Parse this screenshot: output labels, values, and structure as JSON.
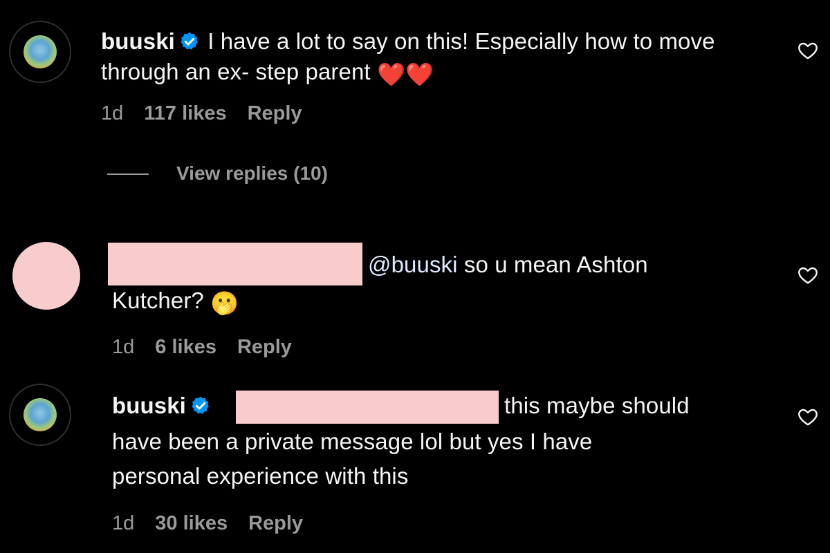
{
  "comments": [
    {
      "username": "buuski",
      "verified": true,
      "text_line1": "I have a lot to say on this! Especially how to move",
      "text_line2": "through an ex- step parent",
      "emoji": "❤️❤️",
      "time": "1d",
      "likes": "117 likes",
      "reply_label": "Reply",
      "view_replies": "View replies (10)"
    },
    {
      "mention": "@buuski",
      "text_line1_rest": "so u mean Ashton",
      "text_line2": "Kutcher?",
      "emoji": "🫢",
      "time": "1d",
      "likes": "6 likes",
      "reply_label": "Reply"
    },
    {
      "username": "buuski",
      "verified": true,
      "text_line1_rest": "this maybe should",
      "text_line2": "have been a private message lol but yes I have",
      "text_line3": "personal experience with this",
      "time": "1d",
      "likes": "30 likes",
      "reply_label": "Reply"
    }
  ],
  "colors": {
    "background": "#000000",
    "text": "#f5f5f5",
    "meta": "#9a9a9a",
    "verified_blue": "#0095f6",
    "redaction_pink": "#f8cccc"
  },
  "icons": [
    "heart-outline-icon",
    "verified-badge-icon"
  ]
}
